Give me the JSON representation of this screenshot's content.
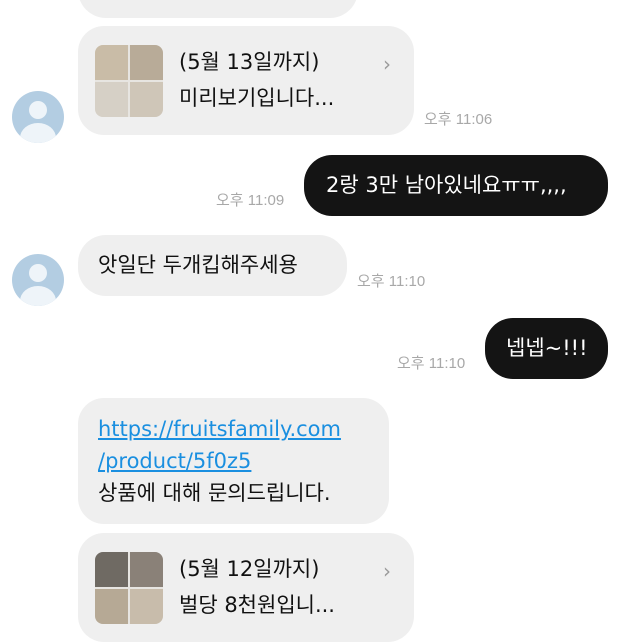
{
  "messages": {
    "card1": {
      "line1": "(5월 13일까지)",
      "line2": "미리보기입니다...",
      "time": "오후 11:06"
    },
    "out1": {
      "text": "2랑 3만 남아있네요ㅠㅠ,,,,",
      "time": "오후 11:09"
    },
    "in1": {
      "text": "앗일단 두개킵해주세용",
      "time": "오후 11:10"
    },
    "out2": {
      "text": "넵넵~!!!",
      "time": "오후 11:10"
    },
    "link_msg": {
      "url_line1": "https://fruitsfamily.com",
      "url_line2": "/product/5f0z5",
      "text": "상품에 대해 문의드립니다."
    },
    "card2": {
      "line1": "(5월 12일까지)",
      "line2": "벌당 8천원입니..."
    }
  },
  "icons": {
    "avatar": "avatar-icon",
    "chevron": "chevron-right-icon"
  }
}
